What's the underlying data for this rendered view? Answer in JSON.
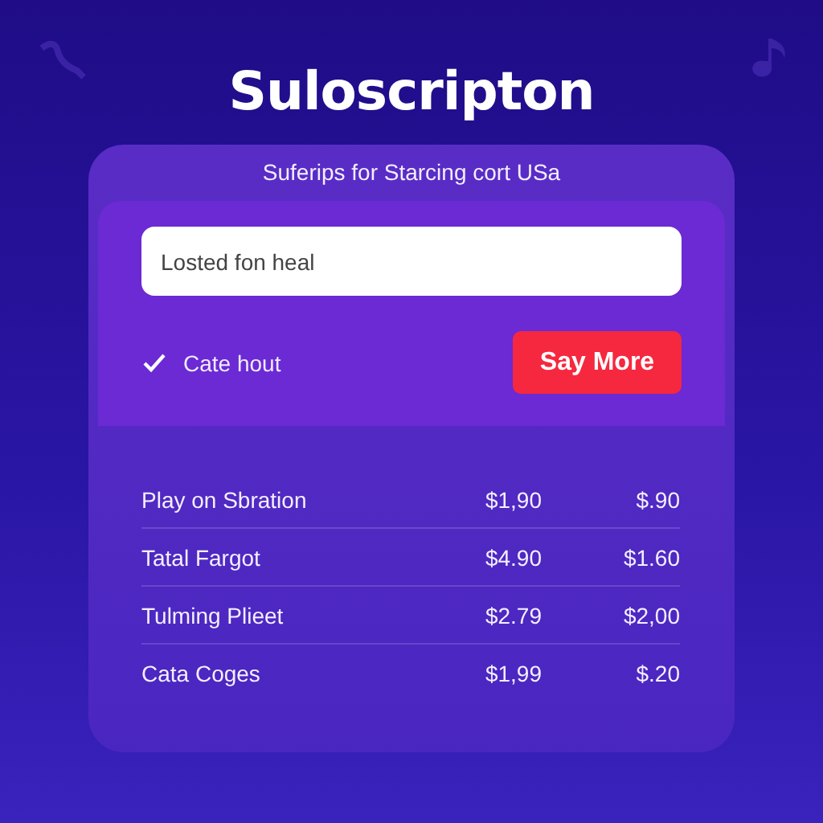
{
  "title": "Suloscripton",
  "card": {
    "subtitle": "Suferips for Starcing cort USa",
    "field": {
      "value": "Losted fon heal"
    },
    "option": {
      "label": "Cate hout",
      "checked": true
    },
    "button": {
      "label": "Say More"
    },
    "rows": [
      {
        "name": "Play on Sbration",
        "price": "$1,90",
        "column_3": "$.90"
      },
      {
        "name": "Tatal Fargot",
        "price": "$4.90",
        "column_3": "$1.60"
      },
      {
        "name": "Tulming Plieet",
        "price": "$2.79",
        "column_3": "$2,00"
      },
      {
        "name": "Cata Coges",
        "price": "$1,99",
        "column_3": "$.20"
      }
    ]
  }
}
